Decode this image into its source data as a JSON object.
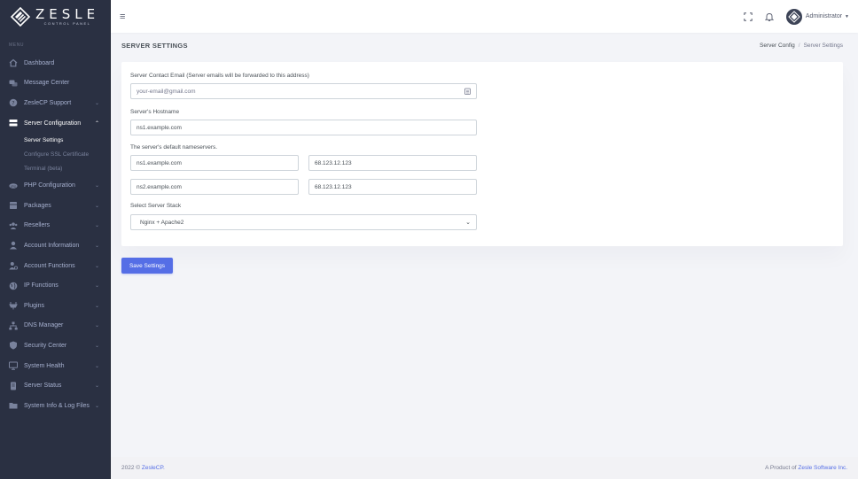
{
  "brand": {
    "name": "ZESLE",
    "subtitle": "CONTROL PANEL"
  },
  "sidebar": {
    "menu_title": "MENU",
    "items": [
      {
        "label": "Dashboard",
        "icon": "home-icon",
        "has_chevron": false
      },
      {
        "label": "Message Center",
        "icon": "chat-icon",
        "has_chevron": false
      },
      {
        "label": "ZesleCP Support",
        "icon": "help-icon",
        "has_chevron": true
      },
      {
        "label": "Server Configuration",
        "icon": "server-icon",
        "has_chevron": true,
        "open": true
      },
      {
        "label": "PHP Configuration",
        "icon": "php-icon",
        "has_chevron": true
      },
      {
        "label": "Packages",
        "icon": "package-icon",
        "has_chevron": true
      },
      {
        "label": "Resellers",
        "icon": "users-icon",
        "has_chevron": true
      },
      {
        "label": "Account Information",
        "icon": "user-icon",
        "has_chevron": true
      },
      {
        "label": "Account Functions",
        "icon": "user-cog-icon",
        "has_chevron": true
      },
      {
        "label": "IP Functions",
        "icon": "globe-icon",
        "has_chevron": true
      },
      {
        "label": "Plugins",
        "icon": "plug-icon",
        "has_chevron": true
      },
      {
        "label": "DNS Manager",
        "icon": "sitemap-icon",
        "has_chevron": true
      },
      {
        "label": "Security Center",
        "icon": "shield-icon",
        "has_chevron": true
      },
      {
        "label": "System Health",
        "icon": "monitor-icon",
        "has_chevron": true
      },
      {
        "label": "Server Status",
        "icon": "database-icon",
        "has_chevron": true
      },
      {
        "label": "System Info & Log Files",
        "icon": "folder-icon",
        "has_chevron": true
      }
    ],
    "server_config_sub": [
      {
        "label": "Server Settings",
        "active": true
      },
      {
        "label": "Configure SSL Certificate",
        "active": false
      },
      {
        "label": "Terminal (beta)",
        "active": false
      }
    ]
  },
  "topbar": {
    "user_name": "Administrator"
  },
  "page": {
    "title": "SERVER SETTINGS",
    "breadcrumb": [
      "Server Config",
      "Server Settings"
    ]
  },
  "form": {
    "email_label": "Server Contact Email (Server emails will be forwarded to this address)",
    "email_placeholder": "your-email@gmail.com",
    "hostname_label": "Server's Hostname",
    "hostname_value": "ns1.example.com",
    "nameservers_label": "The server's default nameservers.",
    "ns1_host": "ns1.example.com",
    "ns1_ip": "68.123.12.123",
    "ns2_host": "ns2.example.com",
    "ns2_ip": "68.123.12.123",
    "stack_label": "Select Server Stack",
    "stack_value": "Nginx + Apache2",
    "save_label": "Save Settings"
  },
  "footer": {
    "copyright_prefix": "2022 © ",
    "copyright_link": "ZesleCP.",
    "product_prefix": "A Product of ",
    "product_link": "Zesle Software Inc."
  },
  "colors": {
    "sidebar_bg": "#2a3042",
    "accent": "#556ee6",
    "page_bg": "#f3f4f8"
  }
}
